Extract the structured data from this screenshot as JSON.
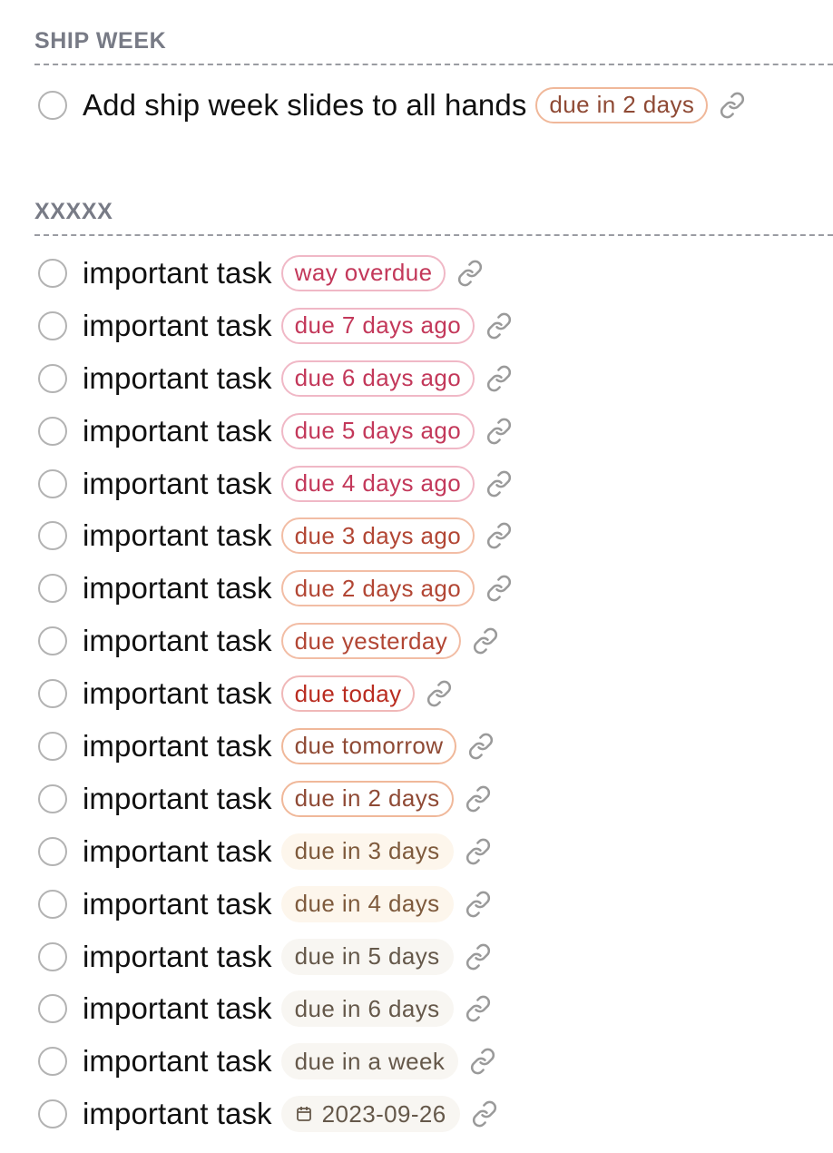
{
  "sections": [
    {
      "title": "SHIP WEEK",
      "tasks": [
        {
          "title": "Add ship week slides to all hands",
          "due": "due in 2 days",
          "tone": "next"
        }
      ]
    },
    {
      "title": "XXXXX",
      "tasks": [
        {
          "title": "important task",
          "due": "way overdue",
          "tone": "overdue"
        },
        {
          "title": "important task",
          "due": "due 7 days ago",
          "tone": "overdue"
        },
        {
          "title": "important task",
          "due": "due 6 days ago",
          "tone": "overdue"
        },
        {
          "title": "important task",
          "due": "due 5 days ago",
          "tone": "overdue"
        },
        {
          "title": "important task",
          "due": "due 4 days ago",
          "tone": "overdue"
        },
        {
          "title": "important task",
          "due": "due 3 days ago",
          "tone": "soon"
        },
        {
          "title": "important task",
          "due": "due 2 days ago",
          "tone": "soon"
        },
        {
          "title": "important task",
          "due": "due yesterday",
          "tone": "soon"
        },
        {
          "title": "important task",
          "due": "due today",
          "tone": "today"
        },
        {
          "title": "important task",
          "due": "due tomorrow",
          "tone": "next"
        },
        {
          "title": "important task",
          "due": "due in 2 days",
          "tone": "next"
        },
        {
          "title": "important task",
          "due": "due in 3 days",
          "tone": "later"
        },
        {
          "title": "important task",
          "due": "due in 4 days",
          "tone": "later"
        },
        {
          "title": "important task",
          "due": "due in 5 days",
          "tone": "far"
        },
        {
          "title": "important task",
          "due": "due in 6 days",
          "tone": "far"
        },
        {
          "title": "important task",
          "due": "due in a week",
          "tone": "far"
        },
        {
          "title": "important task",
          "due": "2023-09-26",
          "tone": "far",
          "icon": "calendar-icon"
        }
      ]
    }
  ],
  "icons": {
    "checkbox": "circle-checkbox-icon",
    "link": "link-icon",
    "calendar": "calendar-icon"
  },
  "colors": {
    "section_title": "#787b86",
    "overdue_text": "#c3385a",
    "today_text": "#b92c20",
    "link_icon": "#9a9a9a"
  }
}
